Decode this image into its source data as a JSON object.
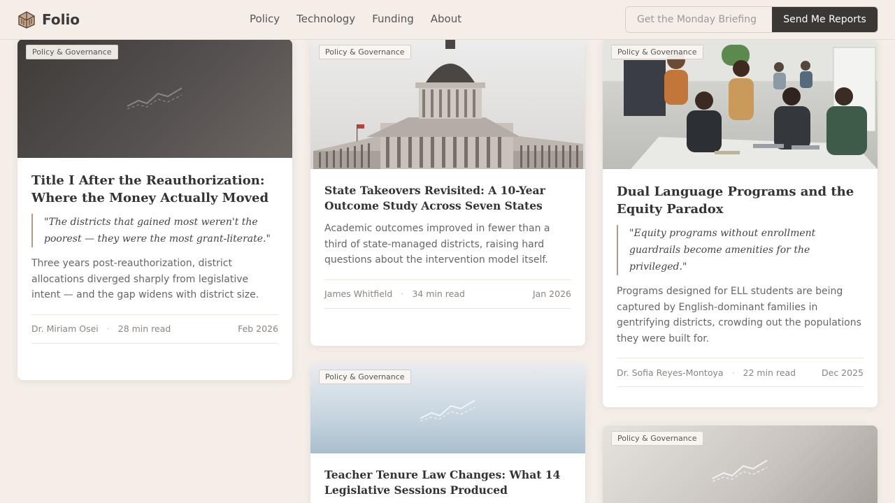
{
  "header": {
    "brand": "Folio",
    "nav": [
      "Policy",
      "Technology",
      "Funding",
      "About"
    ],
    "briefing_placeholder": "Get the Monday Briefing",
    "cta": "Send Me Reports"
  },
  "cards": [
    {
      "tag": "Policy & Governance",
      "title": "Title I After the Reauthorization: Where the Money Actually Moved",
      "quote": "\"The districts that gained most weren't the poorest — they were the most grant-literate.\"",
      "summary": "Three years post-reauthorization, district allocations diverged sharply from legislative intent — and the gap widens with district size.",
      "author": "Dr. Miriam Osei",
      "read": "28 min read",
      "date": "Feb 2026"
    },
    {
      "tag": "Policy & Governance",
      "title": "State Takeovers Revisited: A 10-Year Outcome Study Across Seven States",
      "summary": "Academic outcomes improved in fewer than a third of state-managed districts, raising hard questions about the intervention model itself.",
      "author": "James Whitfield",
      "read": "34 min read",
      "date": "Jan 2026"
    },
    {
      "tag": "Policy & Governance",
      "title": "Dual Language Programs and the Equity Paradox",
      "quote": "\"Equity programs without enrollment guardrails become amenities for the privileged.\"",
      "summary": "Programs designed for ELL students are being captured by English-dominant families in gentrifying districts, crowding out the populations they were built for.",
      "author": "Dr. Sofia Reyes-Montoya",
      "read": "22 min read",
      "date": "Dec 2025"
    },
    {
      "tag": "Policy & Governance",
      "title": "Teacher Tenure Law Changes: What 14 Legislative Sessions Produced"
    },
    {
      "tag": "Policy & Governance"
    }
  ],
  "meta_separator": "·",
  "icons": [
    "folio-logo-icon",
    "trend-line-icon"
  ],
  "colors": {
    "background": "#f5eee8",
    "cta": "#3b3735",
    "quote_rule": "#b79a85"
  }
}
